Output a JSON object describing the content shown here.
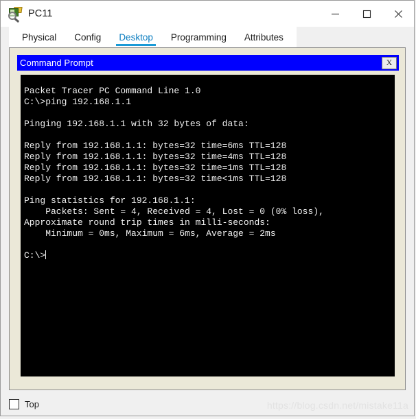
{
  "window": {
    "title": "PC11",
    "icon": "packet-tracer-pc-icon",
    "controls": {
      "minimize_label": "Minimize",
      "maximize_label": "Maximize",
      "close_label": "Close"
    }
  },
  "tabs": [
    {
      "label": "Physical",
      "active": false
    },
    {
      "label": "Config",
      "active": false
    },
    {
      "label": "Desktop",
      "active": true
    },
    {
      "label": "Programming",
      "active": false
    },
    {
      "label": "Attributes",
      "active": false
    }
  ],
  "command_prompt": {
    "title": "Command Prompt",
    "close_label": "X",
    "lines": [
      "Packet Tracer PC Command Line 1.0",
      "C:\\>ping 192.168.1.1",
      "",
      "Pinging 192.168.1.1 with 32 bytes of data:",
      "",
      "Reply from 192.168.1.1: bytes=32 time=6ms TTL=128",
      "Reply from 192.168.1.1: bytes=32 time=4ms TTL=128",
      "Reply from 192.168.1.1: bytes=32 time=1ms TTL=128",
      "Reply from 192.168.1.1: bytes=32 time<1ms TTL=128",
      "",
      "Ping statistics for 192.168.1.1:",
      "    Packets: Sent = 4, Received = 4, Lost = 0 (0% loss),",
      "Approximate round trip times in milli-seconds:",
      "    Minimum = 0ms, Maximum = 6ms, Average = 2ms",
      ""
    ],
    "prompt": "C:\\>"
  },
  "bottom": {
    "top_checkbox_label": "Top",
    "top_checkbox_checked": false,
    "watermark": "https://blog.csdn.net/mistake11a"
  },
  "colors": {
    "accent_tab": "#1a9ad6",
    "cmd_titlebar": "#0000ff",
    "panel_cream": "#ebe8d8",
    "terminal_bg": "#000000",
    "terminal_fg": "#f2f2f2"
  }
}
